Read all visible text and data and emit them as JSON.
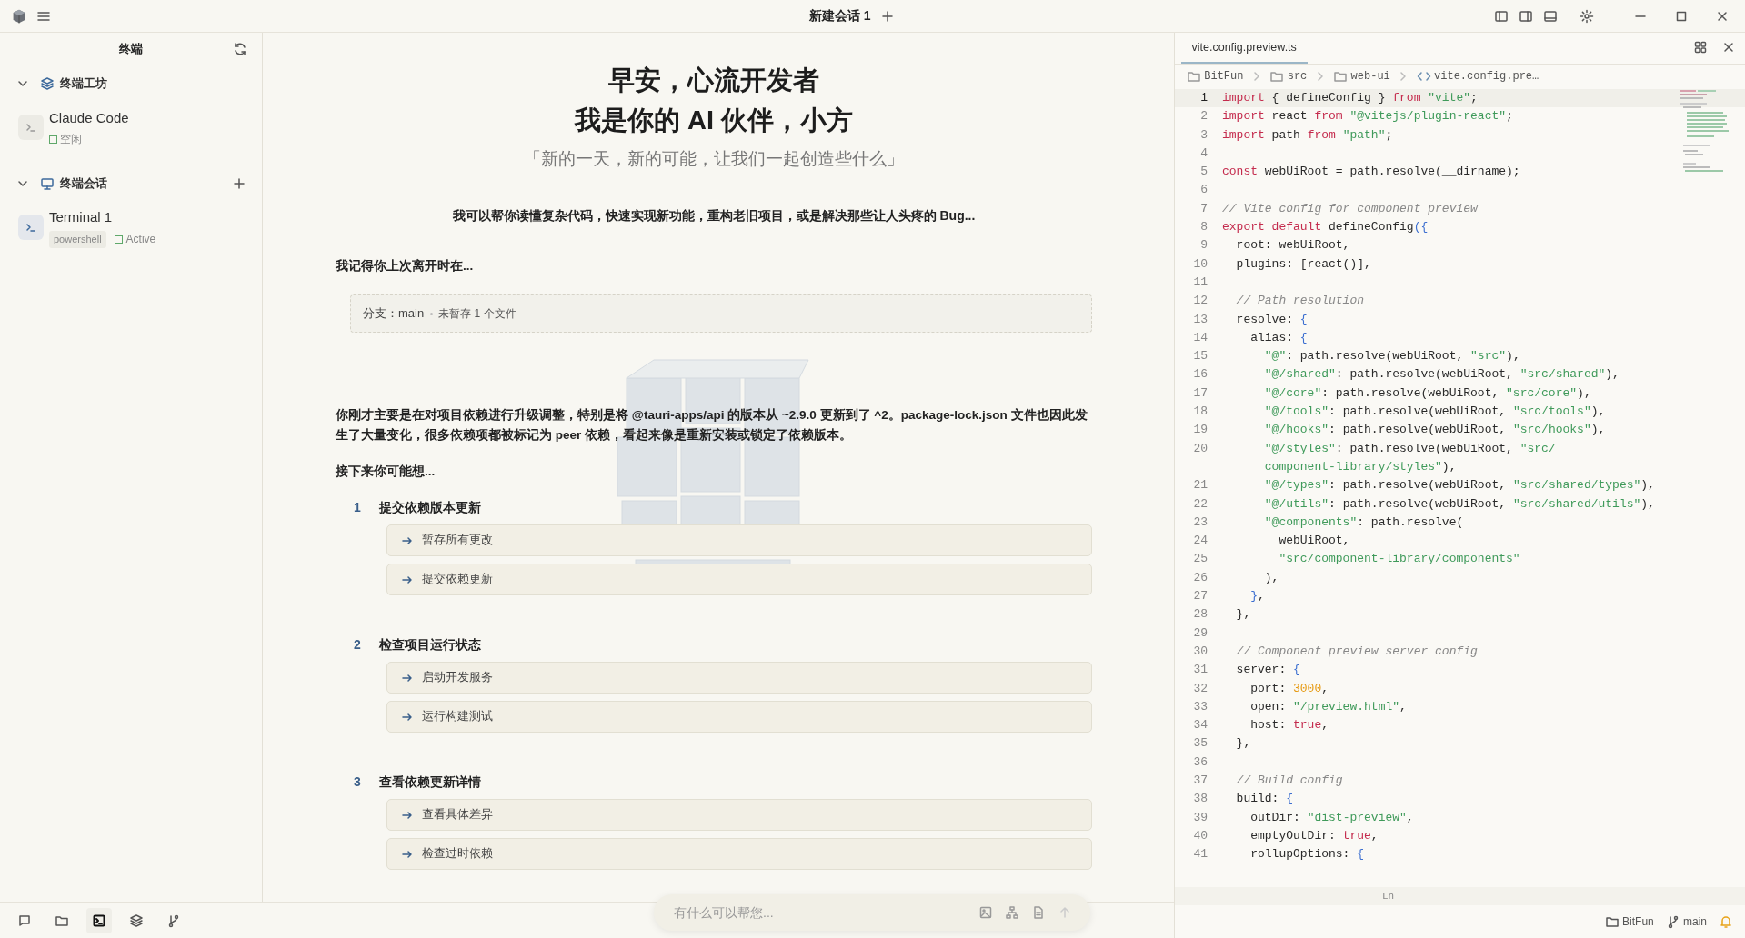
{
  "app_bar": {
    "session_tab": "新建会话 1"
  },
  "sidebar": {
    "title": "终端",
    "sections": [
      {
        "kind": "workshop",
        "title": "终端工坊",
        "expanded": true,
        "items": [
          {
            "name": "Claude Code",
            "status": "空闲",
            "selected": false
          }
        ]
      },
      {
        "kind": "sessions",
        "title": "终端会话",
        "expanded": true,
        "items": [
          {
            "name": "Terminal 1",
            "tag": "powershell",
            "status": "Active",
            "selected": true
          }
        ]
      }
    ]
  },
  "bottom_nav": [
    {
      "kind": "chat",
      "selected": false
    },
    {
      "kind": "folder",
      "selected": false
    },
    {
      "kind": "terminal",
      "selected": true
    },
    {
      "kind": "layers",
      "selected": false
    },
    {
      "kind": "branch",
      "selected": false
    }
  ],
  "welcome": {
    "title_lines": [
      "早安，心流开发者",
      "我是你的 AI 伙伴，小方"
    ],
    "quote": "「新的一天，新的可能，让我们一起创造些什么」",
    "intro": "我可以帮你读懂复杂代码，快速实现新功能，重构老旧项目，或是解决那些让人头疼的 Bug...",
    "memory_heading": "我记得你上次离开时在...",
    "branch": "分支：main",
    "changes": "未暂存 1 个文件",
    "summary": "你刚才主要是在对项目依赖进行升级调整，特别是将 @tauri-apps/api 的版本从 ~2.9.0 更新到了 ^2。package-lock.json 文件也因此发生了大量变化，很多依赖项都被标记为 peer 依赖，看起来像是重新安装或锁定了依赖版本。",
    "next_heading": "接下来你可能想...",
    "steps": [
      {
        "number": "1",
        "title": "提交依赖版本更新",
        "actions": [
          "暂存所有更改",
          "提交依赖更新"
        ]
      },
      {
        "number": "2",
        "title": "检查项目运行状态",
        "actions": [
          "启动开发服务",
          "运行构建测试"
        ]
      },
      {
        "number": "3",
        "title": "查看依赖更新详情",
        "actions": [
          "查看具体差异",
          "检查过时依赖"
        ]
      }
    ]
  },
  "input": {
    "placeholder": "有什么可以帮您..."
  },
  "editor": {
    "tab": "vite.config.preview.ts",
    "breadcrumb": [
      {
        "kind": "folder",
        "label": "BitFun"
      },
      {
        "kind": "folder",
        "label": "src"
      },
      {
        "kind": "folder",
        "label": "web-ui"
      },
      {
        "kind": "file",
        "label": "vite.config.pre…"
      }
    ],
    "lines": [
      {
        "n": "1",
        "current": true,
        "tokens": [
          {
            "kind": "kw",
            "text": "import"
          },
          {
            "kind": "p",
            "text": " { defineConfig } "
          },
          {
            "kind": "kw",
            "text": "from"
          },
          {
            "kind": "s",
            "text": " \"vite\""
          },
          {
            "kind": "p",
            "text": ";"
          }
        ]
      },
      {
        "n": "2",
        "current": false,
        "tokens": [
          {
            "kind": "kw",
            "text": "import"
          },
          {
            "kind": "p",
            "text": " react "
          },
          {
            "kind": "kw",
            "text": "from"
          },
          {
            "kind": "s",
            "text": " \"@vitejs/plugin-react\""
          },
          {
            "kind": "p",
            "text": ";"
          }
        ]
      },
      {
        "n": "3",
        "current": false,
        "tokens": [
          {
            "kind": "kw",
            "text": "import"
          },
          {
            "kind": "p",
            "text": " path "
          },
          {
            "kind": "kw",
            "text": "from"
          },
          {
            "kind": "s",
            "text": " \"path\""
          },
          {
            "kind": "p",
            "text": ";"
          }
        ]
      },
      {
        "n": "4",
        "current": false
      },
      {
        "n": "5",
        "current": false,
        "tokens": [
          {
            "kind": "kw",
            "text": "const"
          },
          {
            "kind": "p",
            "text": " webUiRoot = path.resolve(__dirname);"
          }
        ]
      },
      {
        "n": "6",
        "current": false
      },
      {
        "n": "7",
        "current": false,
        "tokens": [
          {
            "kind": "c",
            "text": "// Vite config for component preview"
          }
        ]
      },
      {
        "n": "8",
        "current": false,
        "tokens": [
          {
            "kind": "kw",
            "text": "export default"
          },
          {
            "kind": "p",
            "text": " defineConfig"
          },
          {
            "kind": "b",
            "text": "({"
          }
        ]
      },
      {
        "n": "9",
        "current": false,
        "tokens": [
          {
            "kind": "p",
            "text": "  root: webUiRoot,"
          }
        ]
      },
      {
        "n": "10",
        "current": false,
        "tokens": [
          {
            "kind": "p",
            "text": "  plugins: [react()],"
          }
        ]
      },
      {
        "n": "11",
        "current": false
      },
      {
        "n": "12",
        "current": false,
        "tokens": [
          {
            "kind": "c",
            "text": "  // Path resolution"
          }
        ]
      },
      {
        "n": "13",
        "current": false,
        "tokens": [
          {
            "kind": "p",
            "text": "  resolve: "
          },
          {
            "kind": "b",
            "text": "{"
          }
        ]
      },
      {
        "n": "14",
        "current": false,
        "tokens": [
          {
            "kind": "p",
            "text": "    alias: "
          },
          {
            "kind": "b",
            "text": "{"
          }
        ]
      },
      {
        "n": "15",
        "current": false,
        "tokens": [
          {
            "kind": "s",
            "text": "      \"@\""
          },
          {
            "kind": "p",
            "text": ": path.resolve(webUiRoot, "
          },
          {
            "kind": "s",
            "text": "\"src\""
          },
          {
            "kind": "p",
            "text": "),"
          }
        ]
      },
      {
        "n": "16",
        "current": false,
        "tokens": [
          {
            "kind": "s",
            "text": "      \"@/shared\""
          },
          {
            "kind": "p",
            "text": ": path.resolve(webUiRoot, "
          },
          {
            "kind": "s",
            "text": "\"src/shared\""
          },
          {
            "kind": "p",
            "text": "),"
          }
        ]
      },
      {
        "n": "17",
        "current": false,
        "tokens": [
          {
            "kind": "s",
            "text": "      \"@/core\""
          },
          {
            "kind": "p",
            "text": ": path.resolve(webUiRoot, "
          },
          {
            "kind": "s",
            "text": "\"src/core\""
          },
          {
            "kind": "p",
            "text": "),"
          }
        ]
      },
      {
        "n": "18",
        "current": false,
        "tokens": [
          {
            "kind": "s",
            "text": "      \"@/tools\""
          },
          {
            "kind": "p",
            "text": ": path.resolve(webUiRoot, "
          },
          {
            "kind": "s",
            "text": "\"src/tools\""
          },
          {
            "kind": "p",
            "text": "),"
          }
        ]
      },
      {
        "n": "19",
        "current": false,
        "tokens": [
          {
            "kind": "s",
            "text": "      \"@/hooks\""
          },
          {
            "kind": "p",
            "text": ": path.resolve(webUiRoot, "
          },
          {
            "kind": "s",
            "text": "\"src/hooks\""
          },
          {
            "kind": "p",
            "text": "),"
          }
        ]
      },
      {
        "n": "20",
        "current": false,
        "tokens": [
          {
            "kind": "s",
            "text": "      \"@/styles\""
          },
          {
            "kind": "p",
            "text": ": path.resolve(webUiRoot, "
          },
          {
            "kind": "s",
            "text": "\"src/"
          }
        ],
        "wrap_tokens": [
          {
            "kind": "s",
            "text": "      component-library/styles\""
          },
          {
            "kind": "p",
            "text": "),"
          }
        ]
      },
      {
        "n": "21",
        "current": false,
        "tokens": [
          {
            "kind": "s",
            "text": "      \"@/types\""
          },
          {
            "kind": "p",
            "text": ": path.resolve(webUiRoot, "
          },
          {
            "kind": "s",
            "text": "\"src/shared/types\""
          },
          {
            "kind": "p",
            "text": "),"
          }
        ]
      },
      {
        "n": "22",
        "current": false,
        "tokens": [
          {
            "kind": "s",
            "text": "      \"@/utils\""
          },
          {
            "kind": "p",
            "text": ": path.resolve(webUiRoot, "
          },
          {
            "kind": "s",
            "text": "\"src/shared/utils\""
          },
          {
            "kind": "p",
            "text": "),"
          }
        ]
      },
      {
        "n": "23",
        "current": false,
        "tokens": [
          {
            "kind": "s",
            "text": "      \"@components\""
          },
          {
            "kind": "p",
            "text": ": path.resolve("
          }
        ]
      },
      {
        "n": "24",
        "current": false,
        "tokens": [
          {
            "kind": "p",
            "text": "        webUiRoot,"
          }
        ]
      },
      {
        "n": "25",
        "current": false,
        "tokens": [
          {
            "kind": "s",
            "text": "        \"src/component-library/components\""
          }
        ]
      },
      {
        "n": "26",
        "current": false,
        "tokens": [
          {
            "kind": "p",
            "text": "      ),"
          }
        ]
      },
      {
        "n": "27",
        "current": false,
        "tokens": [
          {
            "kind": "b",
            "text": "    }"
          },
          {
            "kind": "p",
            "text": ","
          }
        ]
      },
      {
        "n": "28",
        "current": false,
        "tokens": [
          {
            "kind": "p",
            "text": "  },"
          }
        ]
      },
      {
        "n": "29",
        "current": false
      },
      {
        "n": "30",
        "current": false,
        "tokens": [
          {
            "kind": "c",
            "text": "  // Component preview server config"
          }
        ]
      },
      {
        "n": "31",
        "current": false,
        "tokens": [
          {
            "kind": "p",
            "text": "  server: "
          },
          {
            "kind": "b",
            "text": "{"
          }
        ]
      },
      {
        "n": "32",
        "current": false,
        "tokens": [
          {
            "kind": "p",
            "text": "    port: "
          },
          {
            "kind": "n",
            "text": "3000"
          },
          {
            "kind": "p",
            "text": ","
          }
        ]
      },
      {
        "n": "33",
        "current": false,
        "tokens": [
          {
            "kind": "p",
            "text": "    open: "
          },
          {
            "kind": "s",
            "text": "\"/preview.html\""
          },
          {
            "kind": "p",
            "text": ","
          }
        ]
      },
      {
        "n": "34",
        "current": false,
        "tokens": [
          {
            "kind": "p",
            "text": "    host: "
          },
          {
            "kind": "kw",
            "text": "true"
          },
          {
            "kind": "p",
            "text": ","
          }
        ]
      },
      {
        "n": "35",
        "current": false,
        "tokens": [
          {
            "kind": "p",
            "text": "  },"
          }
        ]
      },
      {
        "n": "36",
        "current": false
      },
      {
        "n": "37",
        "current": false,
        "tokens": [
          {
            "kind": "c",
            "text": "  // Build config"
          }
        ]
      },
      {
        "n": "38",
        "current": false,
        "tokens": [
          {
            "kind": "p",
            "text": "  build: "
          },
          {
            "kind": "b",
            "text": "{"
          }
        ]
      },
      {
        "n": "39",
        "current": false,
        "tokens": [
          {
            "kind": "p",
            "text": "    outDir: "
          },
          {
            "kind": "s",
            "text": "\"dist-preview\""
          },
          {
            "kind": "p",
            "text": ","
          }
        ]
      },
      {
        "n": "40",
        "current": false,
        "tokens": [
          {
            "kind": "p",
            "text": "    emptyOutDir: "
          },
          {
            "kind": "kw",
            "text": "true"
          },
          {
            "kind": "p",
            "text": ","
          }
        ]
      },
      {
        "n": "41",
        "current": false,
        "tokens": [
          {
            "kind": "p",
            "text": "    rollupOptions: "
          },
          {
            "kind": "b",
            "text": "{"
          }
        ]
      }
    ],
    "status": "Ln"
  },
  "status_bar": {
    "workspace": "BitFun",
    "branch": "main"
  }
}
